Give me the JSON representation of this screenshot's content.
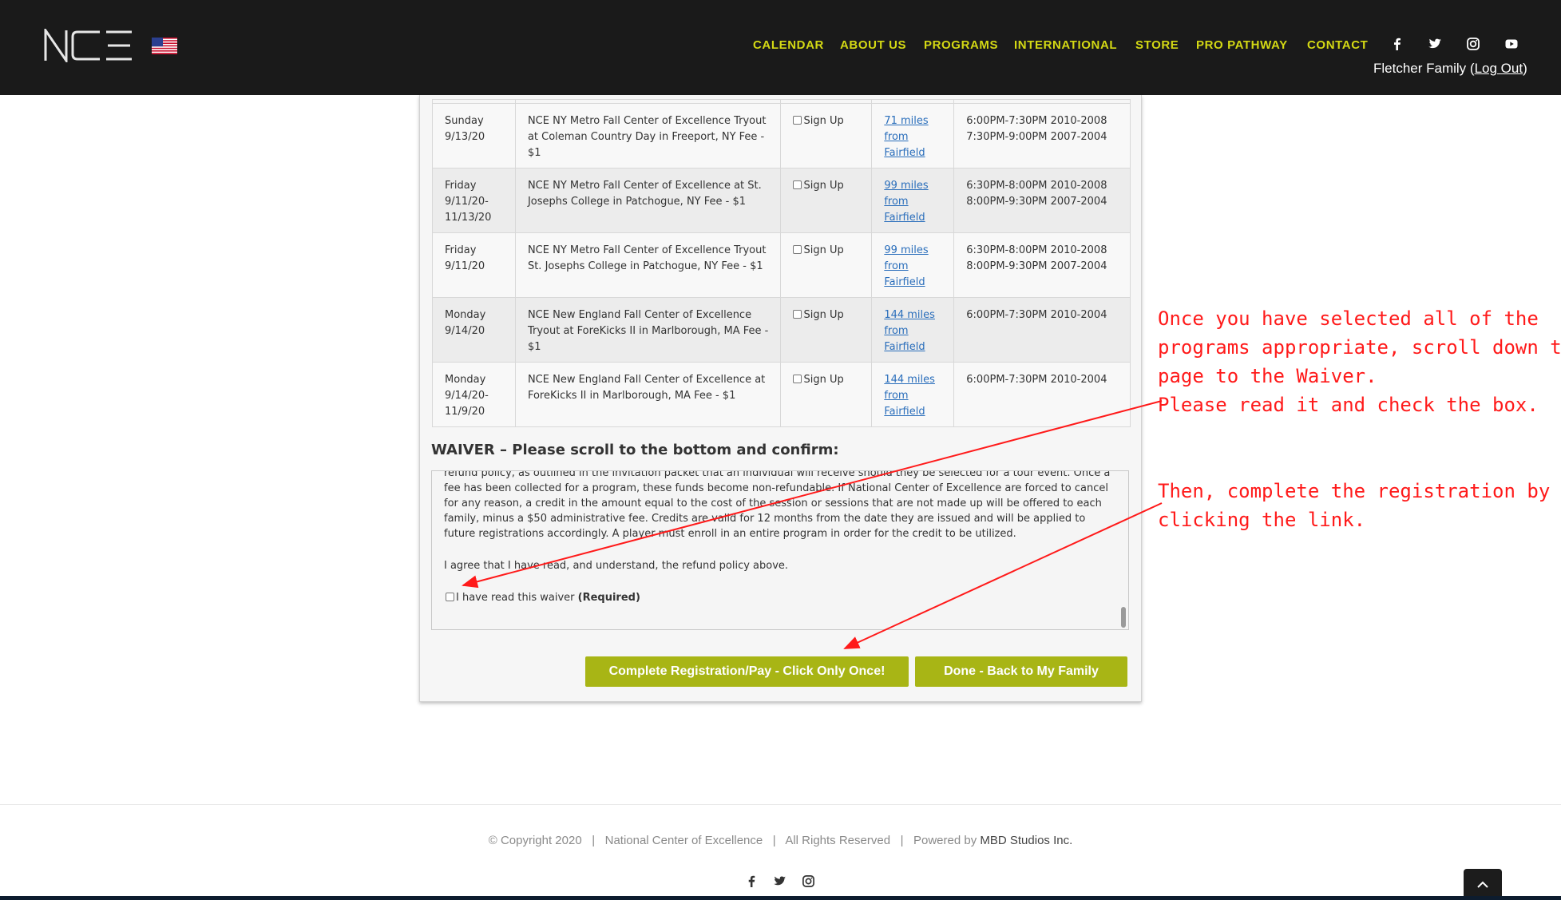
{
  "header": {
    "logo_text": "NCE",
    "nav": [
      "CALENDAR",
      "ABOUT US",
      "PROGRAMS",
      "INTERNATIONAL",
      "STORE",
      "PRO PATHWAY",
      "CONTACT"
    ],
    "social_icons": [
      "facebook-icon",
      "twitter-icon",
      "instagram-icon",
      "youtube-icon"
    ],
    "user_name": "Fletcher Family ",
    "user_action_open": "(",
    "user_action": "Log Out",
    "user_action_close": ")",
    "nav_color": "#d4d914"
  },
  "schedule": {
    "rows": [
      {
        "day": "Sunday",
        "date": "9/13/20",
        "program": "NCE NY Metro Fall Center of Excellence Tryout at Coleman Country Day in Freeport, NY Fee - $1",
        "signup": "Sign Up",
        "distance": "71 miles from Fairfield",
        "d1": "71 miles",
        "d2": "from",
        "d3": "Fairfield",
        "time1": "6:00PM-7:30PM 2010-2008",
        "time2": "7:30PM-9:00PM 2007-2004"
      },
      {
        "day": "Friday",
        "date": "9/11/20-",
        "date2": "11/13/20",
        "program": "NCE NY Metro Fall Center of Excellence at St. Josephs College in Patchogue, NY Fee - $1",
        "signup": "Sign Up",
        "d1": "99 miles",
        "d2": "from",
        "d3": "Fairfield",
        "time1": "6:30PM-8:00PM 2010-2008",
        "time2": "8:00PM-9:30PM 2007-2004"
      },
      {
        "day": "Friday",
        "date": "9/11/20",
        "program": "NCE NY Metro Fall Center of Excellence Tryout St. Josephs College in Patchogue, NY Fee - $1",
        "signup": "Sign Up",
        "d1": "99 miles",
        "d2": "from",
        "d3": "Fairfield",
        "time1": "6:30PM-8:00PM 2010-2008",
        "time2": "8:00PM-9:30PM 2007-2004"
      },
      {
        "day": "Monday",
        "date": "9/14/20",
        "program": "NCE New England Fall Center of Excellence Tryout at ForeKicks II in Marlborough, MA Fee - $1",
        "signup": "Sign Up",
        "d1": "144 miles",
        "d2": "from",
        "d3": "Fairfield",
        "time1": "6:00PM-7:30PM 2010-2004"
      },
      {
        "day": "Monday",
        "date": "9/14/20-",
        "date2": "11/9/20",
        "program": "NCE New England Fall Center of Excellence at ForeKicks II in Marlborough, MA Fee - $1",
        "signup": "Sign Up",
        "d1": "144 miles",
        "d2": "from",
        "d3": "Fairfield",
        "time1": "6:00PM-7:30PM 2010-2004"
      }
    ]
  },
  "waiver": {
    "title": "WAIVER – Please scroll to the bottom and confirm:",
    "text": "refund policy, as outlined in the invitation packet that an individual will receive should they be selected for a tour event. Once a fee has been collected for a program, these funds become non-refundable. If National Center of Excellence are forced to cancel for any reason, a credit in the amount equal to the cost of the session or sessions that are not made up will be offered to each family, minus a $50 administrative fee. Credits are valid for 12 months from the date they are issued and will be applied to future registrations accordingly. A player must enroll in an entire program in order for the credit to be utilized.",
    "agree": "I agree that I have read, and understand, the refund policy above.",
    "checkbox_label": "I have read this waiver ",
    "required": "(Required)"
  },
  "buttons": {
    "complete": "Complete Registration/Pay - Click Only Once!",
    "done": "Done - Back to My Family",
    "color": "#a8b515"
  },
  "annotations": {
    "line1": "Once you have selected all of the",
    "line2": "programs appropriate, scroll down the",
    "line3": "page to the Waiver.",
    "line4": "Please read it and check the box.",
    "line5": "Then, complete the registration by",
    "line6": "clicking the link.",
    "color": "#ff1a1a"
  },
  "footer": {
    "copyright": "© Copyright 2020",
    "sep": "|",
    "org": "National Center of Excellence",
    "rights": "All Rights Reserved",
    "powered": "Powered by ",
    "studio": "MBD Studios Inc.",
    "social_icons": [
      "facebook-icon",
      "twitter-icon",
      "instagram-icon"
    ]
  }
}
